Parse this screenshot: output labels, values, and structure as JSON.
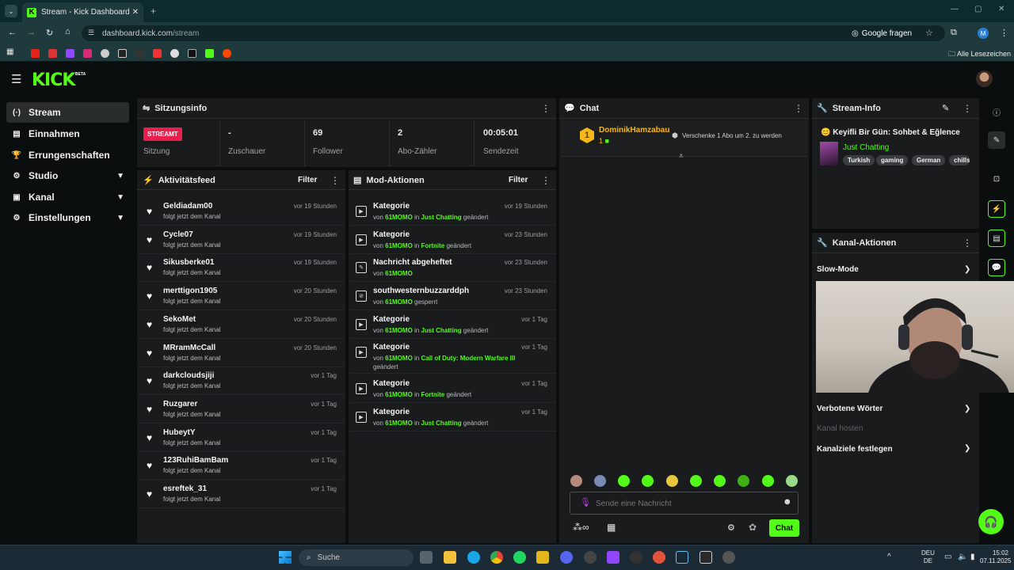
{
  "browser": {
    "tab_title": "Stream - Kick Dashboard",
    "url_host": "dashboard.kick.com",
    "url_path": "/stream",
    "google_btn": "Google fragen",
    "bookmarks_label": "Alle Lesezeichen",
    "profile_initial": "M"
  },
  "app": {
    "logo": "KICK",
    "beta": "BETA"
  },
  "sidebar": {
    "items": [
      {
        "label": "Stream",
        "icon": "(·)"
      },
      {
        "label": "Einnahmen",
        "icon": "▤"
      },
      {
        "label": "Errungenschaften",
        "icon": "🏆"
      },
      {
        "label": "Studio",
        "icon": "⚙"
      },
      {
        "label": "Kanal",
        "icon": "▣"
      },
      {
        "label": "Einstellungen",
        "icon": "⚙"
      }
    ]
  },
  "session": {
    "title": "Sitzungsinfo",
    "live_badge": "STREAMT",
    "stats": [
      {
        "value": "",
        "label": "Sitzung"
      },
      {
        "value": "-",
        "label": "Zuschauer"
      },
      {
        "value": "69",
        "label": "Follower"
      },
      {
        "value": "2",
        "label": "Abo-Zähler"
      },
      {
        "value": "00:05:01",
        "label": "Sendezeit"
      }
    ]
  },
  "activity": {
    "title": "Aktivitätsfeed",
    "filter": "Filter",
    "items": [
      {
        "name": "Geldiadam00",
        "sub": "folgt jetzt dem Kanal",
        "time": "vor 19 Stunden"
      },
      {
        "name": "Cycle07",
        "sub": "folgt jetzt dem Kanal",
        "time": "vor 19 Stunden"
      },
      {
        "name": "Sikusberke01",
        "sub": "folgt jetzt dem Kanal",
        "time": "vor 19 Stunden"
      },
      {
        "name": "merttigon1905",
        "sub": "folgt jetzt dem Kanal",
        "time": "vor 20 Stunden"
      },
      {
        "name": "SekoMet",
        "sub": "folgt jetzt dem Kanal",
        "time": "vor 20 Stunden"
      },
      {
        "name": "MRramMcCall",
        "sub": "folgt jetzt dem Kanal",
        "time": "vor 20 Stunden"
      },
      {
        "name": "darkcloudsjiji",
        "sub": "folgt jetzt dem Kanal",
        "time": "vor 1 Tag"
      },
      {
        "name": "Ruzgarer",
        "sub": "folgt jetzt dem Kanal",
        "time": "vor 1 Tag"
      },
      {
        "name": "HubeytY",
        "sub": "folgt jetzt dem Kanal",
        "time": "vor 1 Tag"
      },
      {
        "name": "123RuhiBamBam",
        "sub": "folgt jetzt dem Kanal",
        "time": "vor 1 Tag"
      },
      {
        "name": "esreftek_31",
        "sub": "folgt jetzt dem Kanal",
        "time": "vor 1 Tag"
      }
    ]
  },
  "mod": {
    "title": "Mod-Aktionen",
    "filter": "Filter",
    "items": [
      {
        "name": "Kategorie",
        "pre": "von ",
        "user": "61MOMO",
        "mid": " in ",
        "target": "Just Chatting",
        "post": " geändert",
        "time": "vor 19 Stunden"
      },
      {
        "name": "Kategorie",
        "pre": "von ",
        "user": "61MOMO",
        "mid": " in ",
        "target": "Fortnite",
        "post": " geändert",
        "time": "vor 23 Stunden"
      },
      {
        "name": "Nachricht abgeheftet",
        "pre": "von ",
        "user": "61MOMO",
        "mid": "",
        "target": "",
        "post": "",
        "time": "vor 23 Stunden"
      },
      {
        "name": "southwesternbuzzarddph",
        "pre": "von ",
        "user": "61MOMO",
        "mid": "",
        "target": "",
        "post": " gesperrt",
        "time": "vor 23 Stunden"
      },
      {
        "name": "Kategorie",
        "pre": "von ",
        "user": "61MOMO",
        "mid": " in ",
        "target": "Just Chatting",
        "post": " geändert",
        "time": "vor 1 Tag"
      },
      {
        "name": "Kategorie",
        "pre": "von ",
        "user": "61MOMO",
        "mid": " in ",
        "target": "Call of Duty: Modern Warfare III",
        "post": " geändert",
        "time": "vor 1 Tag"
      },
      {
        "name": "Kategorie",
        "pre": "von ",
        "user": "61MOMO",
        "mid": " in ",
        "target": "Fortnite",
        "post": " geändert",
        "time": "vor 1 Tag"
      },
      {
        "name": "Kategorie",
        "pre": "von ",
        "user": "61MOMO",
        "mid": " in ",
        "target": "Just Chatting",
        "post": " geändert",
        "time": "vor 1 Tag"
      }
    ]
  },
  "chat": {
    "title": "Chat",
    "gifter": "DominikHamzabau",
    "gift_count": "1",
    "gift_rank": "1",
    "gift_text": "Verschenke 1 Abo um 2. zu werden",
    "placeholder": "Sende eine Nachricht",
    "send": "Chat",
    "infinity": "∞"
  },
  "streaminfo": {
    "title": "Stream-Info",
    "stream_title": "Keyifli Bir Gün: Sohbet & Eğlence",
    "category": "Just Chatting",
    "tags": [
      "Turkish",
      "gaming",
      "German",
      "chills"
    ]
  },
  "channel": {
    "title": "Kanal-Aktionen",
    "slow": "Slow-Mode",
    "banned": "Verbotene Wörter",
    "host": "Kanal hosten",
    "goals": "Kanalziele festlegen"
  },
  "taskbar": {
    "search": "Suche",
    "lang1": "DEU",
    "lang2": "DE",
    "time": "15:02",
    "date": "07.11.2025"
  },
  "colors": {
    "accent": "#53fc18",
    "live": "#e91e4d",
    "panel": "#191b1c"
  }
}
